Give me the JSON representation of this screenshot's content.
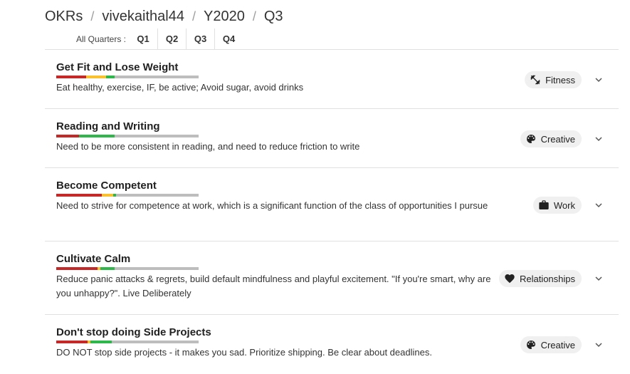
{
  "breadcrumb": {
    "items": [
      "OKRs",
      "vivekaithal44",
      "Y2020",
      "Q3"
    ],
    "separator": "/"
  },
  "quarters": {
    "label": "All Quarters :",
    "tabs": [
      "Q1",
      "Q2",
      "Q3",
      "Q4"
    ]
  },
  "colors": {
    "red": "#c62828",
    "yellow": "#fbc02d",
    "green": "#2eb84b",
    "grey": "#bdbdbd"
  },
  "okrs": [
    {
      "title": "Get Fit and Lose Weight",
      "description": "Eat healthy, exercise, IF, be active; Avoid sugar, avoid drinks",
      "tag": "Fitness",
      "tag_icon": "fitness-icon",
      "progress": [
        {
          "status": "red",
          "fraction": 0.21
        },
        {
          "status": "yellow",
          "fraction": 0.14
        },
        {
          "status": "green",
          "fraction": 0.06
        },
        {
          "status": "grey",
          "fraction": 0.59
        }
      ]
    },
    {
      "title": "Reading and Writing",
      "description": "Need to be more consistent in reading, and need to reduce friction to write",
      "tag": "Creative",
      "tag_icon": "palette-icon",
      "progress": [
        {
          "status": "red",
          "fraction": 0.16
        },
        {
          "status": "green",
          "fraction": 0.25
        },
        {
          "status": "grey",
          "fraction": 0.59
        }
      ]
    },
    {
      "title": "Become Competent",
      "description": "Need to strive for competence at work, which is a significant function of the class of opportunities I pursue",
      "tag": "Work",
      "tag_icon": "briefcase-icon",
      "progress": [
        {
          "status": "red",
          "fraction": 0.32
        },
        {
          "status": "yellow",
          "fraction": 0.08
        },
        {
          "status": "green",
          "fraction": 0.02
        },
        {
          "status": "grey",
          "fraction": 0.58
        }
      ]
    },
    {
      "title": "Cultivate Calm",
      "description": "Reduce panic attacks & regrets, build default mindfulness and playful excitement. \"If you're smart, why are you unhappy?\". Live Deliberately",
      "tag": "Relationships",
      "tag_icon": "heart-icon",
      "progress": [
        {
          "status": "red",
          "fraction": 0.29
        },
        {
          "status": "yellow",
          "fraction": 0.02
        },
        {
          "status": "green",
          "fraction": 0.1
        },
        {
          "status": "grey",
          "fraction": 0.59
        }
      ]
    },
    {
      "title": "Don't stop doing Side Projects",
      "description": "DO NOT stop side projects - it makes you sad. Prioritize shipping. Be clear about deadlines.",
      "tag": "Creative",
      "tag_icon": "palette-icon",
      "progress": [
        {
          "status": "red",
          "fraction": 0.22
        },
        {
          "status": "yellow",
          "fraction": 0.02
        },
        {
          "status": "green",
          "fraction": 0.15
        },
        {
          "status": "grey",
          "fraction": 0.61
        }
      ]
    }
  ]
}
